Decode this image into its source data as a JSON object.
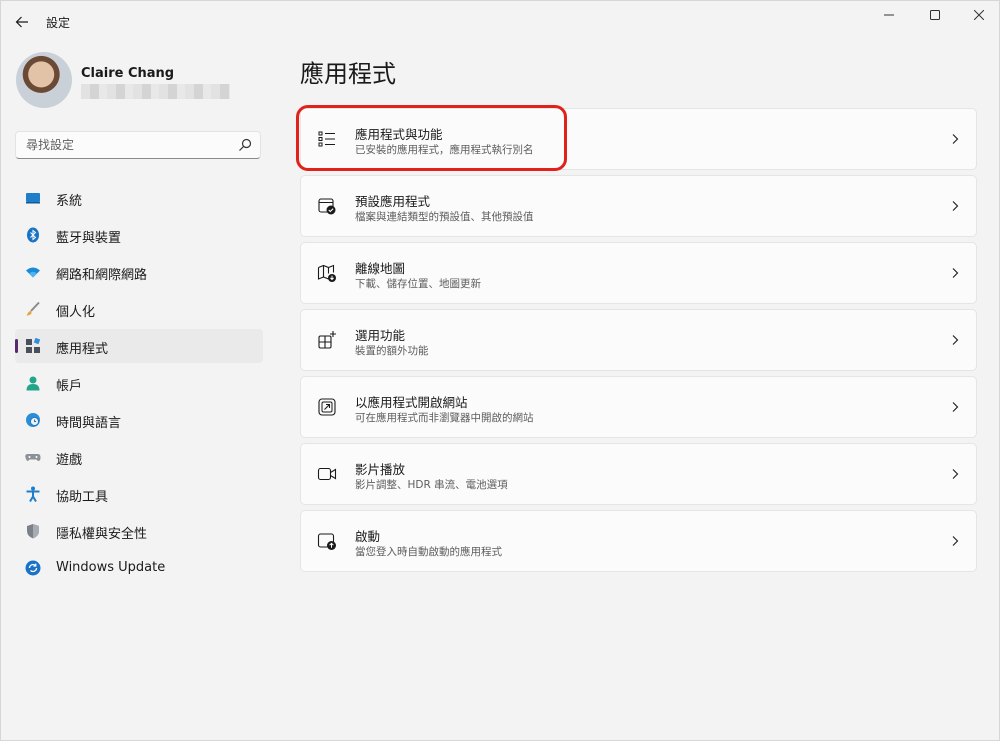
{
  "window": {
    "title": "設定",
    "minimize_label": "",
    "maximize_label": "",
    "close_label": ""
  },
  "profile": {
    "name": "Claire Chang"
  },
  "search": {
    "placeholder": "尋找設定"
  },
  "sidebar": {
    "items": [
      {
        "label": "系統",
        "icon": "system-icon",
        "selected": false
      },
      {
        "label": "藍牙與裝置",
        "icon": "bluetooth-icon",
        "selected": false
      },
      {
        "label": "網路和網際網路",
        "icon": "wifi-icon",
        "selected": false
      },
      {
        "label": "個人化",
        "icon": "brush-icon",
        "selected": false
      },
      {
        "label": "應用程式",
        "icon": "apps-icon",
        "selected": true
      },
      {
        "label": "帳戶",
        "icon": "account-icon",
        "selected": false
      },
      {
        "label": "時間與語言",
        "icon": "globe-clock-icon",
        "selected": false
      },
      {
        "label": "遊戲",
        "icon": "gamepad-icon",
        "selected": false
      },
      {
        "label": "協助工具",
        "icon": "accessibility-icon",
        "selected": false
      },
      {
        "label": "隱私權與安全性",
        "icon": "shield-icon",
        "selected": false
      },
      {
        "label": "Windows Update",
        "icon": "update-icon",
        "selected": false
      }
    ]
  },
  "main": {
    "title": "應用程式",
    "cards": [
      {
        "title": "應用程式與功能",
        "subtitle": "已安裝的應用程式，應用程式執行別名",
        "icon": "list-icon"
      },
      {
        "title": "預設應用程式",
        "subtitle": "檔案與連結類型的預設值、其他預設值",
        "icon": "default-apps-icon"
      },
      {
        "title": "離線地圖",
        "subtitle": "下載、儲存位置、地圖更新",
        "icon": "offline-map-icon"
      },
      {
        "title": "選用功能",
        "subtitle": "裝置的額外功能",
        "icon": "optional-features-icon"
      },
      {
        "title": "以應用程式開啟網站",
        "subtitle": "可在應用程式而非瀏覽器中開啟的網站",
        "icon": "open-website-icon"
      },
      {
        "title": "影片播放",
        "subtitle": "影片調整、HDR 串流、電池選項",
        "icon": "video-icon"
      },
      {
        "title": "啟動",
        "subtitle": "當您登入時自動啟動的應用程式",
        "icon": "startup-icon"
      }
    ]
  },
  "colors": {
    "accent": "#5a2a6e",
    "highlight": "#e0221b",
    "background": "#f3f3f3",
    "card": "#fbfbfb"
  }
}
